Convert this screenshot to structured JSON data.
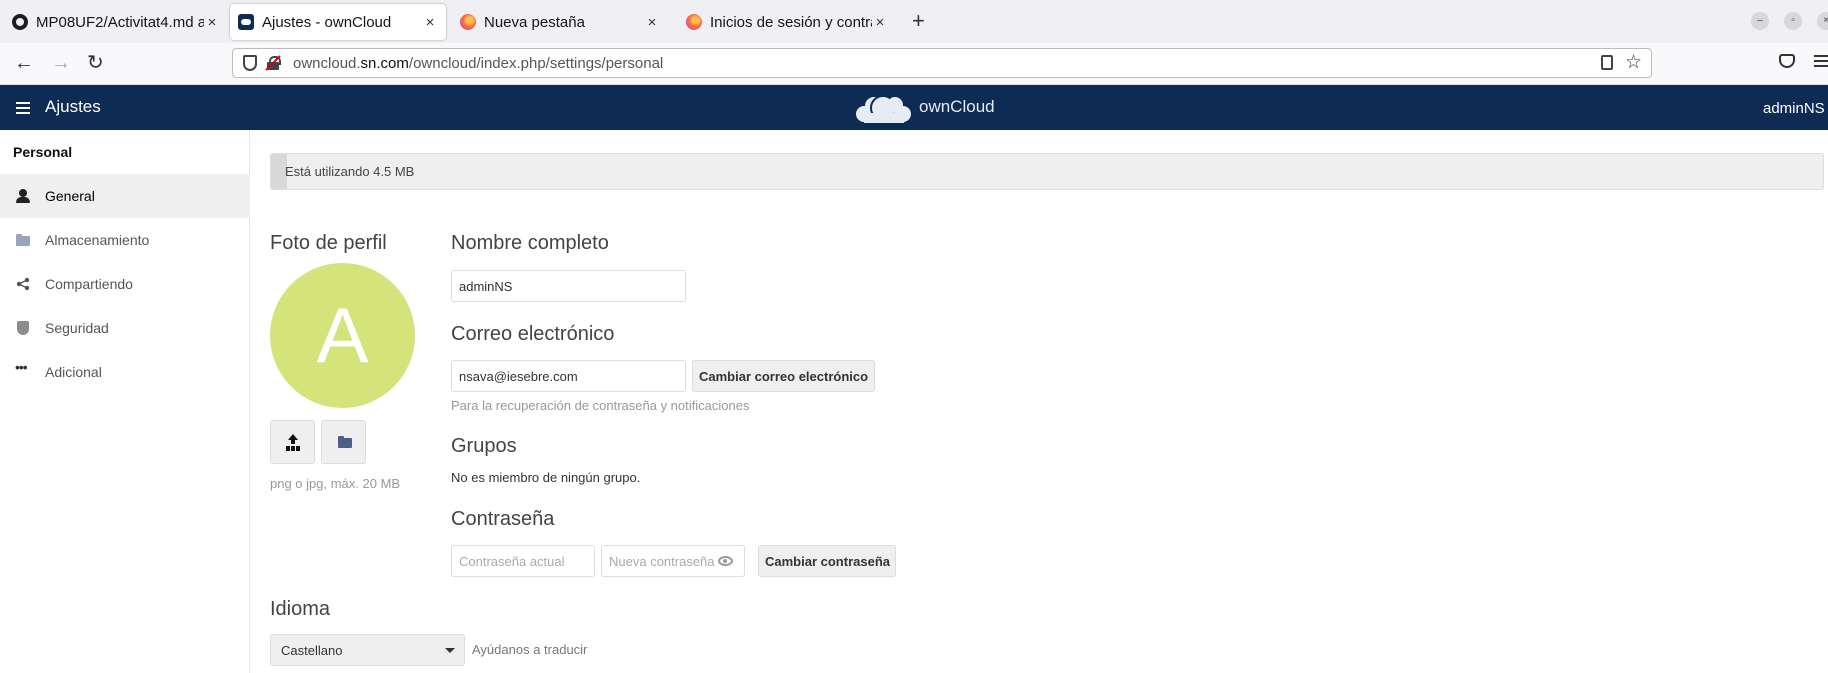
{
  "browser": {
    "tabs": [
      {
        "title": "MP08UF2/Activitat4.md a",
        "icon": "github-icon",
        "active": false
      },
      {
        "title": "Ajustes - ownCloud",
        "icon": "owncloud-icon",
        "active": true
      },
      {
        "title": "Nueva pestaña",
        "icon": "firefox-icon",
        "active": false
      },
      {
        "title": "Inicios de sesión y contra",
        "icon": "firefox-icon",
        "active": false
      }
    ],
    "new_tab_label": "+",
    "url": {
      "prefix": "owncloud.",
      "domain": "sn.com",
      "path": "/owncloud/index.php/settings/personal"
    },
    "window_controls": {
      "minimize": "–",
      "maximize": "▫",
      "close": "×"
    }
  },
  "header": {
    "app_title": "Ajustes",
    "logo_text": "ownCloud",
    "user": "adminNS",
    "user_caret": "▾"
  },
  "sidebar": {
    "section": "Personal",
    "items": [
      {
        "label": "General",
        "icon": "person-icon",
        "active": true
      },
      {
        "label": "Almacenamiento",
        "icon": "folder-icon",
        "active": false
      },
      {
        "label": "Compartiendo",
        "icon": "share-icon",
        "active": false
      },
      {
        "label": "Seguridad",
        "icon": "shield-icon",
        "active": false
      },
      {
        "label": "Adicional",
        "icon": "more-icon",
        "active": false
      }
    ]
  },
  "quota": {
    "text": "Está utilizando 4.5 MB",
    "used_fraction": 0.01
  },
  "profile": {
    "photo_title": "Foto de perfil",
    "avatar_letter": "A",
    "avatar_color": "#d4e37a",
    "photo_hint": "png o jpg, máx. 20 MB"
  },
  "fullname": {
    "title": "Nombre completo",
    "value": "adminNS"
  },
  "email": {
    "title": "Correo electrónico",
    "value": "nsava@iesebre.com",
    "button": "Cambiar correo electrónico",
    "hint": "Para la recuperación de contraseña y notificaciones"
  },
  "groups": {
    "title": "Grupos",
    "text": "No es miembro de ningún grupo."
  },
  "password": {
    "title": "Contraseña",
    "current_placeholder": "Contraseña actual",
    "new_placeholder": "Nueva contraseña",
    "button": "Cambiar contraseña"
  },
  "language": {
    "title": "Idioma",
    "selected": "Castellano",
    "help_link": "Ayúdanos a traducir"
  },
  "colors": {
    "header": "#0d2b53",
    "avatar": "#d4e37a"
  }
}
